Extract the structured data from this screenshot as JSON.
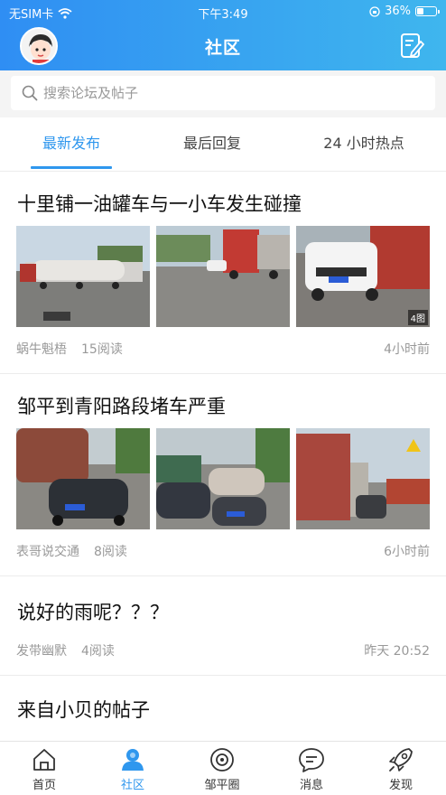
{
  "status_bar": {
    "carrier": "无SIM卡",
    "time": "下午3:49",
    "battery": "36%",
    "battery_level": 0.36
  },
  "header": {
    "title": "社区"
  },
  "search": {
    "placeholder": "搜索论坛及帖子"
  },
  "tabs": [
    {
      "label": "最新发布",
      "active": true
    },
    {
      "label": "最后回复",
      "active": false
    },
    {
      "label": "24 小时热点",
      "active": false
    }
  ],
  "posts": [
    {
      "title": "十里铺一油罐车与一小车发生碰撞",
      "author": "蜗牛魁梧",
      "reads": "15阅读",
      "time": "4小时前",
      "image_count": "4图"
    },
    {
      "title": "邹平到青阳路段堵车严重",
      "author": "表哥说交通",
      "reads": "8阅读",
      "time": "6小时前"
    },
    {
      "title": "说好的雨呢？？？",
      "author": "发带幽默",
      "reads": "4阅读",
      "time": "昨天 20:52"
    },
    {
      "title": "来自小贝的帖子"
    }
  ],
  "tabbar": [
    {
      "label": "首页",
      "icon": "home-icon"
    },
    {
      "label": "社区",
      "icon": "community-icon",
      "active": true
    },
    {
      "label": "邹平圈",
      "icon": "circle-icon"
    },
    {
      "label": "消息",
      "icon": "message-icon"
    },
    {
      "label": "发现",
      "icon": "rocket-icon"
    }
  ],
  "colors": {
    "accent": "#2f97ee",
    "header_start": "#2f8ef3",
    "header_end": "#3fb6ee"
  }
}
